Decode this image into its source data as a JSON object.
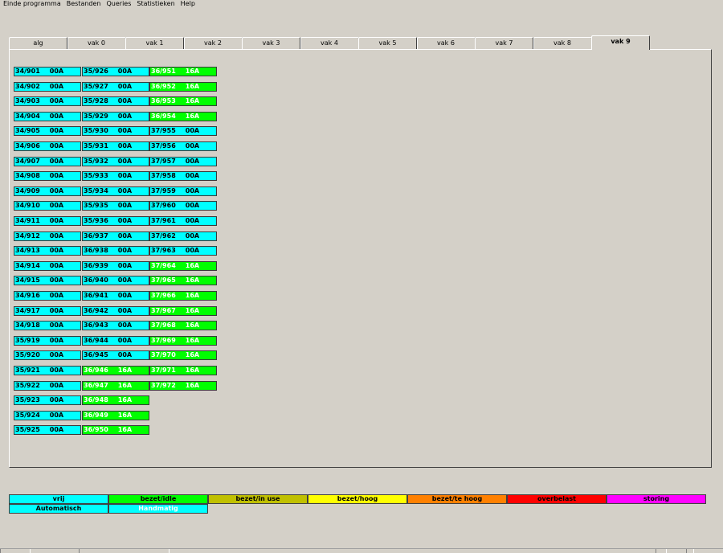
{
  "menu": [
    "Einde programma",
    "Bestanden",
    "Queries",
    "Statistieken",
    "Help"
  ],
  "tabs": [
    "alg",
    "vak 0",
    "vak 1",
    "vak 2",
    "vak 3",
    "vak 4",
    "vak 5",
    "vak 6",
    "vak 7",
    "vak 8",
    "vak 9"
  ],
  "active_tab": "vak 9",
  "colors": {
    "vrij": "#00ffff",
    "bezet_idle": "#00ff00",
    "bezet_in_use": "#c0c000",
    "bezet_hoog": "#ffff00",
    "bezet_te_hoog": "#ff8000",
    "overbelast": "#ff0000",
    "storing": "#ff00ff",
    "text_on_green": "#ffffff",
    "text_default": "#000000"
  },
  "grid": {
    "columns": [
      [
        {
          "id": "34/901",
          "val": "00A",
          "status": "vrij"
        },
        {
          "id": "34/902",
          "val": "00A",
          "status": "vrij"
        },
        {
          "id": "34/903",
          "val": "00A",
          "status": "vrij"
        },
        {
          "id": "34/904",
          "val": "00A",
          "status": "vrij"
        },
        {
          "id": "34/905",
          "val": "00A",
          "status": "vrij"
        },
        {
          "id": "34/906",
          "val": "00A",
          "status": "vrij"
        },
        {
          "id": "34/907",
          "val": "00A",
          "status": "vrij"
        },
        {
          "id": "34/908",
          "val": "00A",
          "status": "vrij"
        },
        {
          "id": "34/909",
          "val": "00A",
          "status": "vrij"
        },
        {
          "id": "34/910",
          "val": "00A",
          "status": "vrij"
        },
        {
          "id": "34/911",
          "val": "00A",
          "status": "vrij"
        },
        {
          "id": "34/912",
          "val": "00A",
          "status": "vrij"
        },
        {
          "id": "34/913",
          "val": "00A",
          "status": "vrij"
        },
        {
          "id": "34/914",
          "val": "00A",
          "status": "vrij"
        },
        {
          "id": "34/915",
          "val": "00A",
          "status": "vrij"
        },
        {
          "id": "34/916",
          "val": "00A",
          "status": "vrij"
        },
        {
          "id": "34/917",
          "val": "00A",
          "status": "vrij"
        },
        {
          "id": "34/918",
          "val": "00A",
          "status": "vrij"
        },
        {
          "id": "35/919",
          "val": "00A",
          "status": "vrij"
        },
        {
          "id": "35/920",
          "val": "00A",
          "status": "vrij"
        },
        {
          "id": "35/921",
          "val": "00A",
          "status": "vrij"
        },
        {
          "id": "35/922",
          "val": "00A",
          "status": "vrij"
        },
        {
          "id": "35/923",
          "val": "00A",
          "status": "vrij"
        },
        {
          "id": "35/924",
          "val": "00A",
          "status": "vrij"
        },
        {
          "id": "35/925",
          "val": "00A",
          "status": "vrij"
        }
      ],
      [
        {
          "id": "35/926",
          "val": "00A",
          "status": "vrij"
        },
        {
          "id": "35/927",
          "val": "00A",
          "status": "vrij"
        },
        {
          "id": "35/928",
          "val": "00A",
          "status": "vrij"
        },
        {
          "id": "35/929",
          "val": "00A",
          "status": "vrij"
        },
        {
          "id": "35/930",
          "val": "00A",
          "status": "vrij"
        },
        {
          "id": "35/931",
          "val": "00A",
          "status": "vrij"
        },
        {
          "id": "35/932",
          "val": "00A",
          "status": "vrij"
        },
        {
          "id": "35/933",
          "val": "00A",
          "status": "vrij"
        },
        {
          "id": "35/934",
          "val": "00A",
          "status": "vrij"
        },
        {
          "id": "35/935",
          "val": "00A",
          "status": "vrij"
        },
        {
          "id": "35/936",
          "val": "00A",
          "status": "vrij"
        },
        {
          "id": "36/937",
          "val": "00A",
          "status": "vrij"
        },
        {
          "id": "36/938",
          "val": "00A",
          "status": "vrij"
        },
        {
          "id": "36/939",
          "val": "00A",
          "status": "vrij"
        },
        {
          "id": "36/940",
          "val": "00A",
          "status": "vrij"
        },
        {
          "id": "36/941",
          "val": "00A",
          "status": "vrij"
        },
        {
          "id": "36/942",
          "val": "00A",
          "status": "vrij"
        },
        {
          "id": "36/943",
          "val": "00A",
          "status": "vrij"
        },
        {
          "id": "36/944",
          "val": "00A",
          "status": "vrij"
        },
        {
          "id": "36/945",
          "val": "00A",
          "status": "vrij"
        },
        {
          "id": "36/946",
          "val": "16A",
          "status": "bezet_idle"
        },
        {
          "id": "36/947",
          "val": "16A",
          "status": "bezet_idle"
        },
        {
          "id": "36/948",
          "val": "16A",
          "status": "bezet_idle"
        },
        {
          "id": "36/949",
          "val": "16A",
          "status": "bezet_idle"
        },
        {
          "id": "36/950",
          "val": "16A",
          "status": "bezet_idle"
        }
      ],
      [
        {
          "id": "36/951",
          "val": "16A",
          "status": "bezet_idle"
        },
        {
          "id": "36/952",
          "val": "16A",
          "status": "bezet_idle"
        },
        {
          "id": "36/953",
          "val": "16A",
          "status": "bezet_idle"
        },
        {
          "id": "36/954",
          "val": "16A",
          "status": "bezet_idle"
        },
        {
          "id": "37/955",
          "val": "00A",
          "status": "vrij"
        },
        {
          "id": "37/956",
          "val": "00A",
          "status": "vrij"
        },
        {
          "id": "37/957",
          "val": "00A",
          "status": "vrij"
        },
        {
          "id": "37/958",
          "val": "00A",
          "status": "vrij"
        },
        {
          "id": "37/959",
          "val": "00A",
          "status": "vrij"
        },
        {
          "id": "37/960",
          "val": "00A",
          "status": "vrij"
        },
        {
          "id": "37/961",
          "val": "00A",
          "status": "vrij"
        },
        {
          "id": "37/962",
          "val": "00A",
          "status": "vrij"
        },
        {
          "id": "37/963",
          "val": "00A",
          "status": "vrij"
        },
        {
          "id": "37/964",
          "val": "16A",
          "status": "bezet_idle"
        },
        {
          "id": "37/965",
          "val": "16A",
          "status": "bezet_idle"
        },
        {
          "id": "37/966",
          "val": "16A",
          "status": "bezet_idle"
        },
        {
          "id": "37/967",
          "val": "16A",
          "status": "bezet_idle"
        },
        {
          "id": "37/968",
          "val": "16A",
          "status": "bezet_idle"
        },
        {
          "id": "37/969",
          "val": "16A",
          "status": "bezet_idle"
        },
        {
          "id": "37/970",
          "val": "16A",
          "status": "bezet_idle"
        },
        {
          "id": "37/971",
          "val": "16A",
          "status": "bezet_idle"
        },
        {
          "id": "37/972",
          "val": "16A",
          "status": "bezet_idle"
        }
      ]
    ]
  },
  "legend": {
    "row1": [
      {
        "label": "vrij",
        "status": "vrij"
      },
      {
        "label": "bezet/idle",
        "status": "bezet_idle"
      },
      {
        "label": "bezet/in use",
        "status": "bezet_in_use"
      },
      {
        "label": "bezet/hoog",
        "status": "bezet_hoog"
      },
      {
        "label": "bezet/te hoog",
        "status": "bezet_te_hoog"
      },
      {
        "label": "overbelast",
        "status": "overbelast"
      },
      {
        "label": "storing",
        "status": "storing"
      }
    ],
    "row2": [
      {
        "label": "Automatisch",
        "status": "vrij"
      },
      {
        "label": "Handmatig",
        "status": "vrij",
        "text": "text_on_green"
      }
    ]
  }
}
